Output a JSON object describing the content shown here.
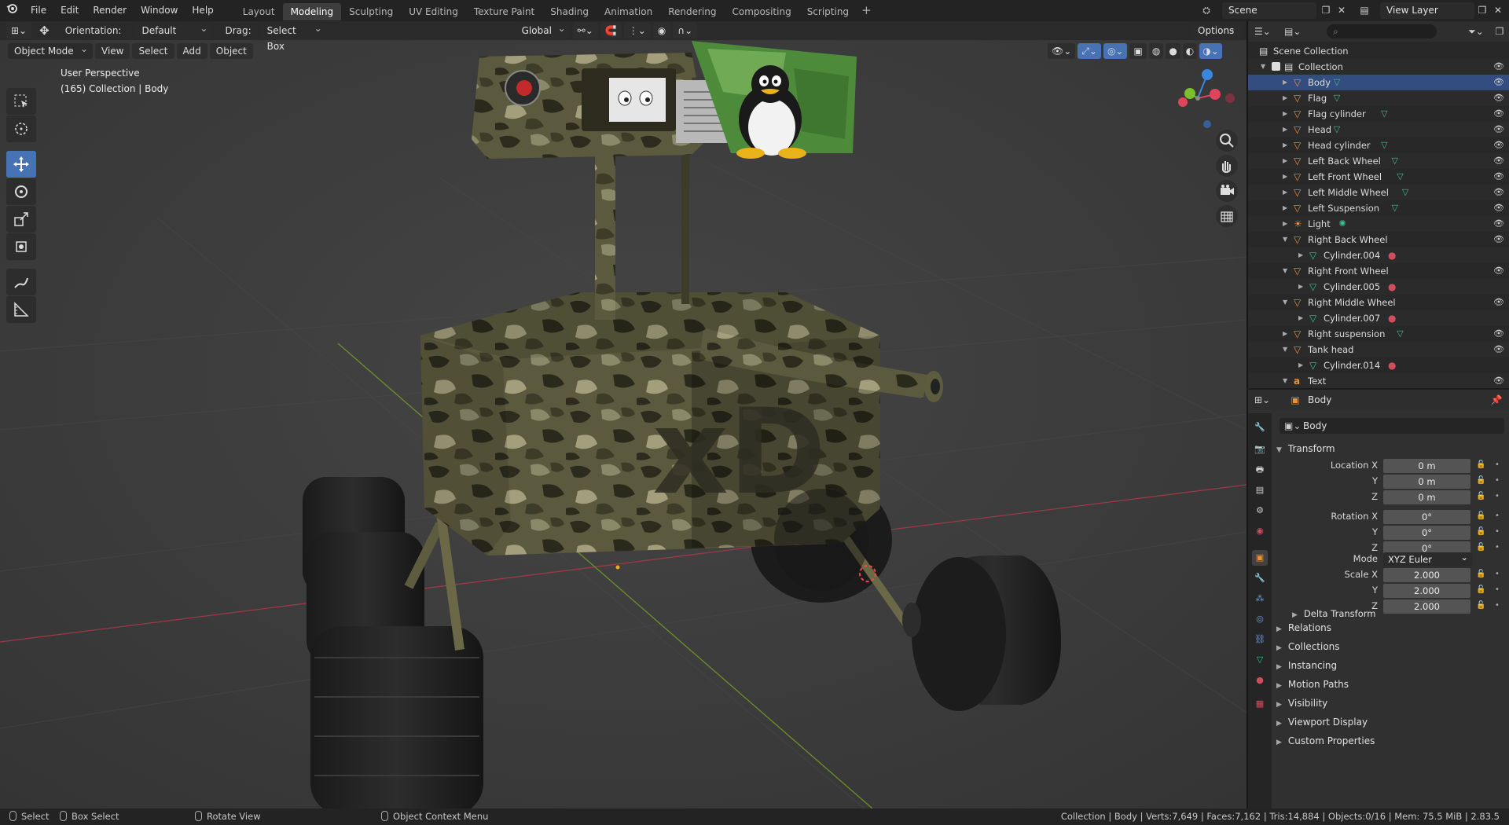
{
  "menu": [
    "File",
    "Edit",
    "Render",
    "Window",
    "Help"
  ],
  "workspaces": [
    "Layout",
    "Modeling",
    "Sculpting",
    "UV Editing",
    "Texture Paint",
    "Shading",
    "Animation",
    "Rendering",
    "Compositing",
    "Scripting"
  ],
  "active_workspace": "Modeling",
  "scene_name": "Scene",
  "view_layer": "View Layer",
  "header": {
    "orientation_label": "Orientation:",
    "orientation_value": "Default",
    "drag_label": "Drag:",
    "drag_value": "Select Box",
    "transform_orientation": "Global",
    "options_label": "Options"
  },
  "viewport_header": {
    "mode": "Object Mode",
    "view": "View",
    "select": "Select",
    "add": "Add",
    "object": "Object"
  },
  "viewport": {
    "perspective": "User Perspective",
    "collection_info": "(165) Collection | Body",
    "model_text": "xD"
  },
  "outliner": {
    "root": "Scene Collection",
    "collection": "Collection",
    "items": [
      {
        "name": "Body",
        "type": "mesh",
        "selected": true
      },
      {
        "name": "Flag",
        "type": "mesh"
      },
      {
        "name": "Flag cylinder",
        "type": "mesh"
      },
      {
        "name": "Head",
        "type": "mesh"
      },
      {
        "name": "Head cylinder",
        "type": "mesh"
      },
      {
        "name": "Left Back Wheel",
        "type": "mesh"
      },
      {
        "name": "Left Front Wheel",
        "type": "mesh"
      },
      {
        "name": "Left Middle Wheel",
        "type": "mesh"
      },
      {
        "name": "Left Suspension",
        "type": "mesh"
      },
      {
        "name": "Light",
        "type": "light"
      },
      {
        "name": "Right Back Wheel",
        "type": "mesh",
        "expanded": true
      },
      {
        "name": "Cylinder.004",
        "type": "child"
      },
      {
        "name": "Right Front Wheel",
        "type": "mesh",
        "expanded": true
      },
      {
        "name": "Cylinder.005",
        "type": "child"
      },
      {
        "name": "Right Middle Wheel",
        "type": "mesh",
        "expanded": true
      },
      {
        "name": "Cylinder.007",
        "type": "child"
      },
      {
        "name": "Right suspension",
        "type": "mesh"
      },
      {
        "name": "Tank head",
        "type": "mesh",
        "expanded": true
      },
      {
        "name": "Cylinder.014",
        "type": "child"
      },
      {
        "name": "Text",
        "type": "text"
      }
    ]
  },
  "properties": {
    "object_name": "Body",
    "object_field": "Body",
    "transform_title": "Transform",
    "location_x_label": "Location X",
    "rotation_x_label": "Rotation X",
    "scale_x_label": "Scale X",
    "y_label": "Y",
    "z_label": "Z",
    "mode_label": "Mode",
    "location": [
      "0 m",
      "0 m",
      "0 m"
    ],
    "rotation": [
      "0°",
      "0°",
      "0°"
    ],
    "rotation_mode": "XYZ Euler",
    "scale": [
      "2.000",
      "2.000",
      "2.000"
    ],
    "delta_transform": "Delta Transform",
    "panels": [
      "Relations",
      "Collections",
      "Instancing",
      "Motion Paths",
      "Visibility",
      "Viewport Display",
      "Custom Properties"
    ]
  },
  "statusbar": {
    "select": "Select",
    "box_select": "Box Select",
    "rotate_view": "Rotate View",
    "context_menu": "Object Context Menu",
    "stats": "Collection | Body | Verts:7,649 | Faces:7,162 | Tris:14,884 | Objects:0/16 | Mem: 75.5 MiB | 2.83.5"
  },
  "colors": {
    "accent": "#4772b3",
    "mesh_icon": "#e8923a",
    "data_icon": "#3dbd8b",
    "material_icon": "#d04e5c",
    "x_axis": "#e0445a",
    "y_axis": "#7bbf2a",
    "z_axis": "#3a86e0"
  }
}
